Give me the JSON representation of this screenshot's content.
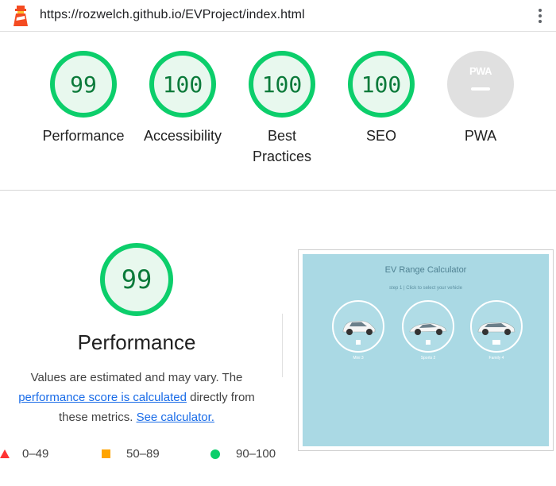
{
  "browser": {
    "url": "https://rozwelch.github.io/EVProject/index.html",
    "logo_icon": "lighthouse-icon",
    "menu_icon": "more-vert-icon"
  },
  "categories": [
    {
      "label": "Performance",
      "score": "99"
    },
    {
      "label": "Accessibility",
      "score": "100"
    },
    {
      "label": "Best Practices",
      "score": "100"
    },
    {
      "label": "SEO",
      "score": "100"
    },
    {
      "label": "PWA",
      "badge_text": "PWA"
    }
  ],
  "performance": {
    "score": "99",
    "title": "Performance",
    "desc_prefix": "Values are estimated and may vary. The",
    "desc_link": "performance score is calculated",
    "desc_middle": "directly from these metrics.",
    "desc_link2": "See calculator."
  },
  "legend": [
    {
      "range": "0–49",
      "shape": "triangle",
      "color": "#ff3333"
    },
    {
      "range": "50–89",
      "shape": "square",
      "color": "#ffa400"
    },
    {
      "range": "90–100",
      "shape": "circle",
      "color": "#0cce6b"
    }
  ],
  "screenshot": {
    "title": "EV Range Calculator",
    "step": "step 1 | Click to select your vehicle",
    "vehicles": [
      "Mini 3",
      "Sports 2",
      "Family 4"
    ]
  },
  "colors": {
    "pass": "#0cce6b",
    "pass_text": "#0b7a3a",
    "link": "#1a6ce8",
    "thumb_bg": "#aad9e4"
  }
}
